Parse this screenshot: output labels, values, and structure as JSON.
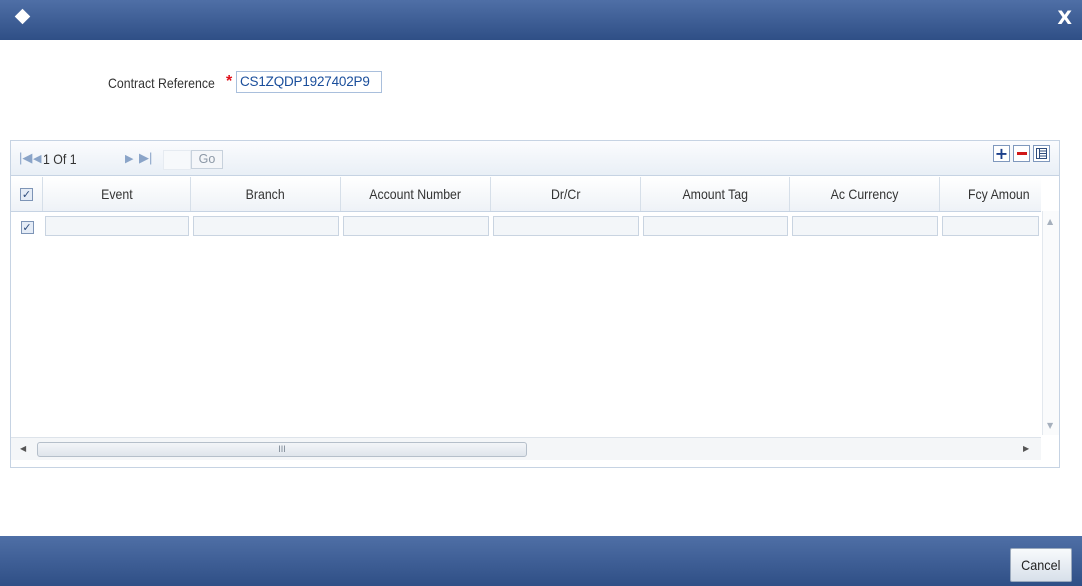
{
  "window": {
    "title_icon": "diamond-icon",
    "close_glyph": "X"
  },
  "form": {
    "contract_ref_label": "Contract Reference",
    "required_marker": "*",
    "contract_ref_value": "CS1ZQDP1927402P9"
  },
  "pagination": {
    "first_glyph": "|◀",
    "prev_glyph": "◀",
    "page_text": "1 Of 1",
    "next_glyph": "▶",
    "last_glyph": "▶|",
    "go_label": "Go"
  },
  "toolbar": {
    "add_icon": "plus-icon",
    "add_glyph": "+",
    "delete_icon": "minus-icon",
    "columns_icon": "column-list-icon"
  },
  "table": {
    "select_all_checked": true,
    "columns": [
      "Event",
      "Branch",
      "Account Number",
      "Dr/Cr",
      "Amount Tag",
      "Ac Currency",
      "Fcy Amoun"
    ],
    "rows": [
      {
        "checked": true,
        "cells": [
          "",
          "",
          "",
          "",
          "",
          "",
          ""
        ]
      }
    ]
  },
  "scrollbars": {
    "up_arrow": "▲",
    "down_arrow": "▼",
    "left_arrow": "◀",
    "right_arrow": "▶",
    "thumb_grip": "III"
  },
  "footer": {
    "cancel_label": "Cancel"
  },
  "colors": {
    "titlebar": "#3d5e96",
    "required": "#e0101a",
    "ref_text": "#1a4e9b"
  }
}
